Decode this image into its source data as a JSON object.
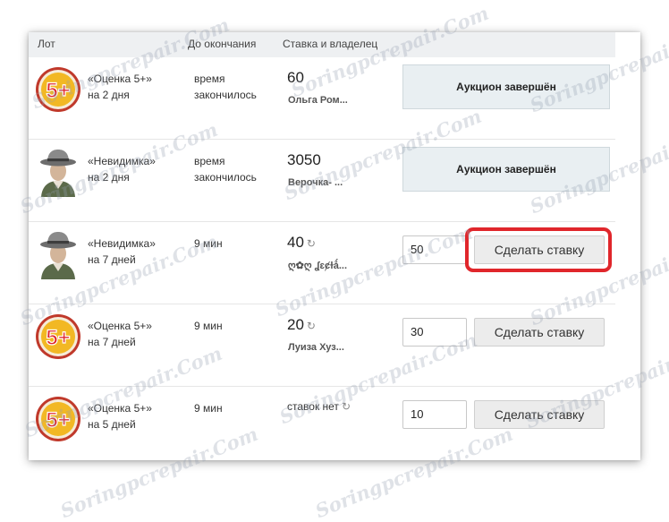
{
  "header": {
    "col_lot": "Лот",
    "col_time": "До окончания",
    "col_bid": "Ставка и владелец"
  },
  "rows": [
    {
      "icon": "five-plus-badge",
      "lot_name": "«Оценка 5+»",
      "lot_duration": "на 2 дня",
      "time_line1": "время",
      "time_line2": "закончилось",
      "bid": "60",
      "owner": "Ольга Ром...",
      "status": "Аукцион завершён"
    },
    {
      "icon": "invisible-man-avatar",
      "lot_name": "«Невидимка»",
      "lot_duration": "на 2 дня",
      "time_line1": "время",
      "time_line2": "закончилось",
      "bid": "3050",
      "owner": "Верочка- ...",
      "status": "Аукцион завершён"
    },
    {
      "icon": "invisible-man-avatar",
      "lot_name": "«Невидимка»",
      "lot_duration": "на 7 дней",
      "time_left": "9 мин",
      "bid": "40",
      "owner": "ღ✿ღ ʆɛȼɫǻ...",
      "input_value": "50",
      "button_label": "Сделать ставку",
      "highlighted": true
    },
    {
      "icon": "five-plus-badge",
      "lot_name": "«Оценка 5+»",
      "lot_duration": "на 7 дней",
      "time_left": "9 мин",
      "bid": "20",
      "owner": "Луиза Хуз...",
      "input_value": "30",
      "button_label": "Сделать ставку"
    },
    {
      "icon": "five-plus-badge",
      "lot_name": "«Оценка 5+»",
      "lot_duration": "на 5 дней",
      "time_left": "9 мин",
      "no_bids": "ставок нет",
      "input_value": "10",
      "button_label": "Сделать ставку"
    }
  ],
  "refresh_glyph": "↻",
  "badge_text": "5+",
  "watermark": "Soringpcrepair.Com",
  "colors": {
    "highlight": "#e0262b",
    "badge_fill": "#f2b824",
    "badge_ring": "#c0392b",
    "badge_text": "#e0262b"
  }
}
